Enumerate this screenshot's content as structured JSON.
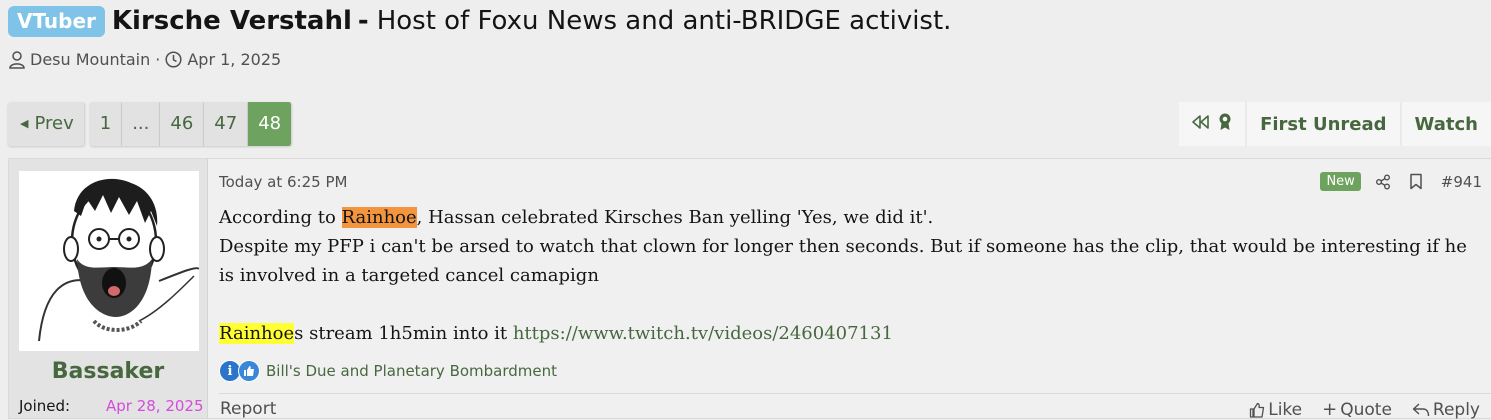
{
  "thread": {
    "prefix": "VTuber",
    "title_main": "Kirsche Verstahl",
    "title_sep": "-",
    "title_sub": "Host of Foxu News and anti-BRIDGE activist.",
    "author": "Desu Mountain",
    "separator": "·",
    "date": "Apr 1, 2025"
  },
  "pagination": {
    "prev_label": "Prev",
    "pages": [
      "1",
      "...",
      "46",
      "47",
      "48"
    ],
    "current": "48"
  },
  "actions": {
    "first_unread": "First Unread",
    "watch": "Watch"
  },
  "post": {
    "user": {
      "name": "Bassaker",
      "joined_label": "Joined:",
      "joined_date": "Apr 28, 2025"
    },
    "date": "Today at 6:25 PM",
    "new_badge": "New",
    "number": "#941",
    "line1_pre": "According to ",
    "line1_hl": "Rainhoe",
    "line1_post": ", Hassan celebrated Kirsches Ban yelling 'Yes, we did it'.",
    "line2": "Despite my PFP i can't be arsed to watch that clown for longer then seconds. But if someone has the clip, that would be interesting if he is involved in a targeted cancel camapign",
    "line3_hl": "Rainhoe",
    "line3_text": "s stream 1h5min into it ",
    "line3_link": "https://www.twitch.tv/videos/2460407131",
    "reactions_users": "Bill's Due and Planetary Bombardment",
    "report": "Report",
    "like": "Like",
    "quote": "Quote",
    "reply": "Reply"
  },
  "colors": {
    "accent": "#47683f",
    "current_page": "#6ea25f",
    "prefix_badge": "#7fc4e8",
    "highlight_orange": "#f3943e",
    "highlight_yellow": "#ffff33",
    "joined_date": "#d44bdc"
  },
  "icons": [
    "user-icon",
    "clock-icon",
    "caret-left-icon",
    "rewind-icon",
    "award-icon",
    "share-icon",
    "bookmark-icon",
    "info-reaction-icon",
    "like-reaction-icon",
    "thumbs-up-icon",
    "plus-icon",
    "reply-arrow-icon"
  ]
}
